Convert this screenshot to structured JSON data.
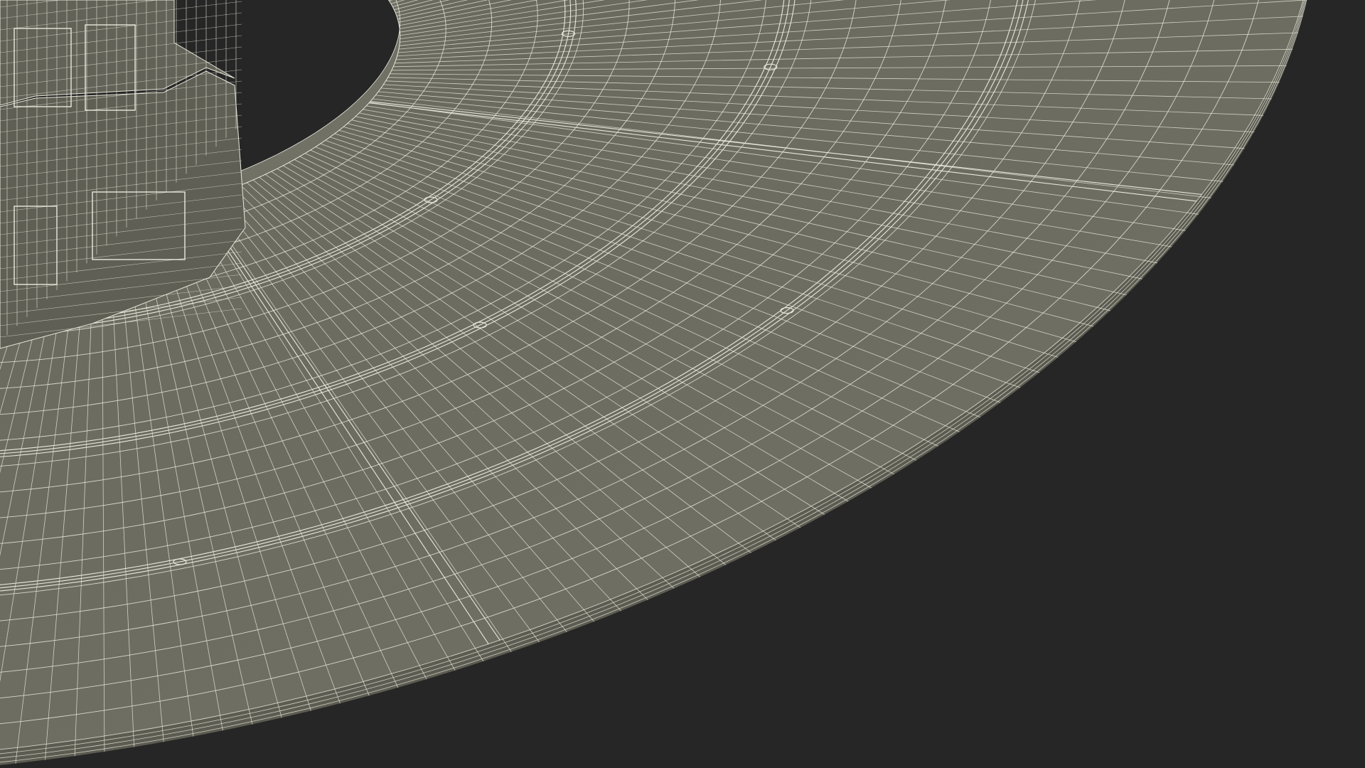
{
  "scene": {
    "subject": "wireframe-render",
    "colors": {
      "background": "#262626",
      "surface": "#6b6b5f",
      "surface_shaded": "#5c5c52",
      "surface_light": "#717165",
      "wire": "#e9e9dc",
      "base_wall": "#5f5f55",
      "base_top": "#626258"
    }
  }
}
